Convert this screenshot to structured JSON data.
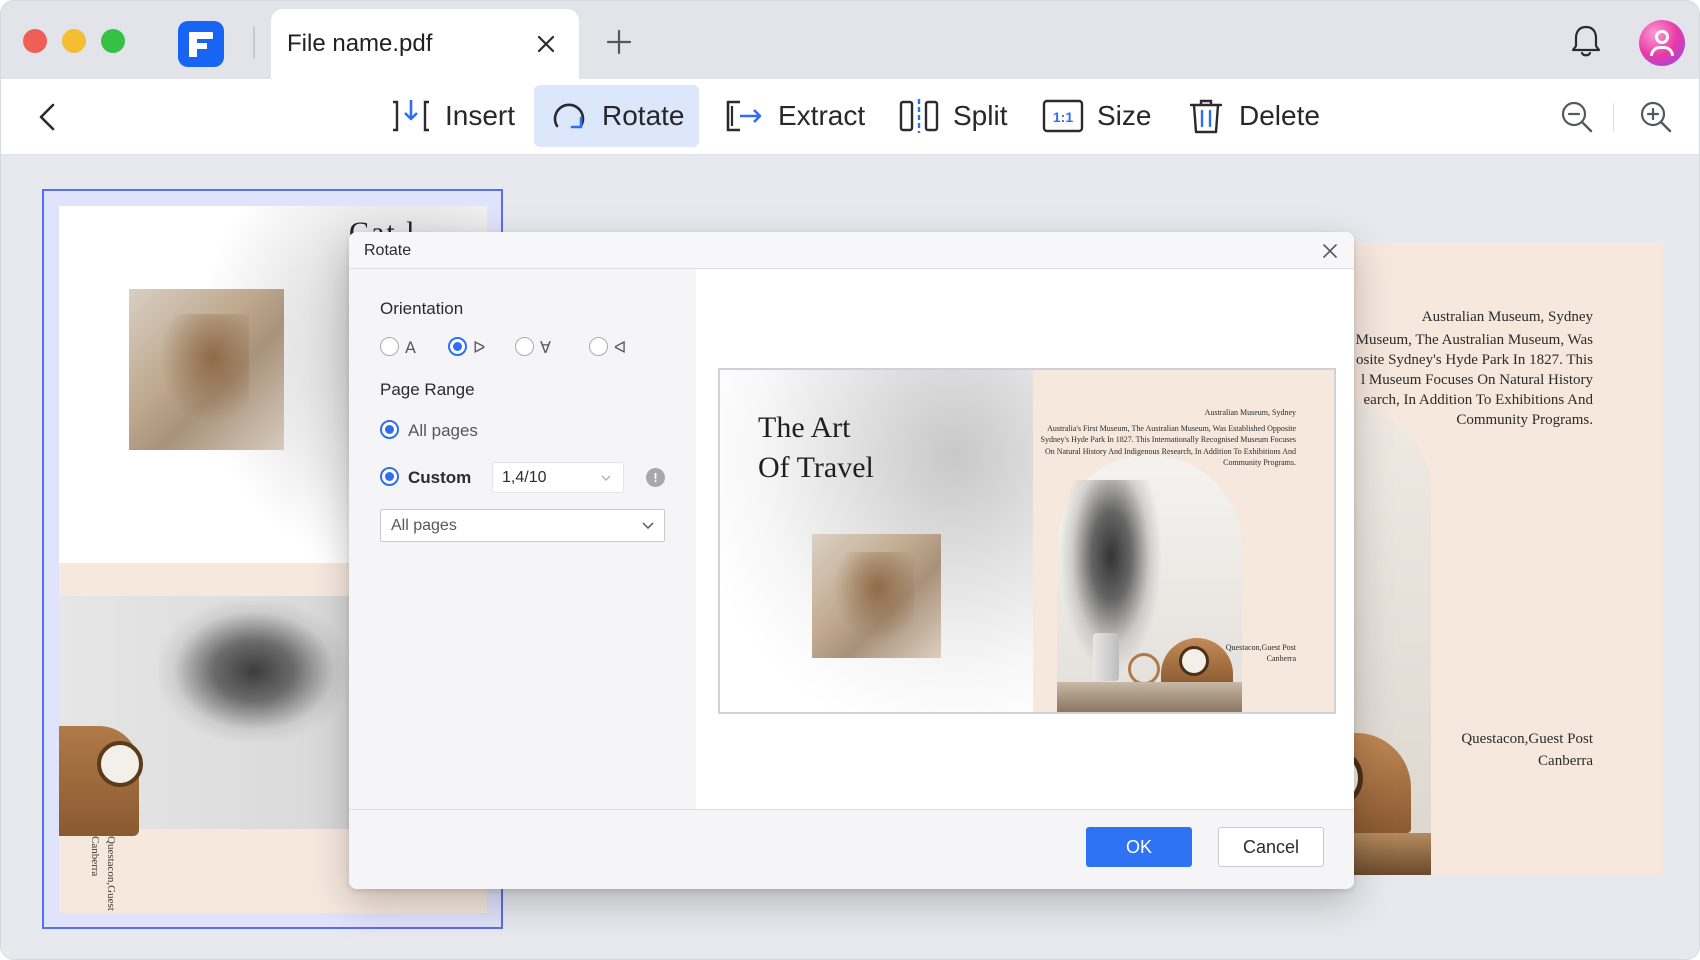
{
  "titlebar": {
    "tab_title": "File name.pdf"
  },
  "toolbar": {
    "tools": [
      {
        "label": "Insert",
        "icon": "insert-icon"
      },
      {
        "label": "Rotate",
        "icon": "rotate-icon",
        "active": true
      },
      {
        "label": "Extract",
        "icon": "extract-icon"
      },
      {
        "label": "Split",
        "icon": "split-icon"
      },
      {
        "label": "Size",
        "icon": "size-icon",
        "icon_text": "1:1"
      },
      {
        "label": "Delete",
        "icon": "trash-icon"
      }
    ],
    "accent_color": "#dde7fb"
  },
  "dialog": {
    "title": "Rotate",
    "orientation": {
      "label": "Orientation",
      "options": [
        {
          "glyph": "A",
          "selected": false
        },
        {
          "glyph": "ᐅ",
          "selected": true
        },
        {
          "glyph": "∀",
          "selected": false
        },
        {
          "glyph": "ᐊ",
          "selected": false
        }
      ]
    },
    "page_range": {
      "label": "Page Range",
      "all_pages_label": "All pages",
      "custom_label": "Custom",
      "custom_value": "1,4/10",
      "info_glyph": "!",
      "subset_value": "All pages"
    },
    "preview": {
      "title": "The Art\nOf Travel",
      "body_heading": "Australian Museum, Sydney",
      "body_text": "Australia's First Museum, The Australian Museum, Was Established Opposite Sydney's Hyde Park In 1827. This Internationally Recognised Museum Focuses On Natural History And Indigenous Research, In Addition To Exhibitions And Community Programs.",
      "caption_line1": "Questacon,Guest Post",
      "caption_line2": "Canberra"
    },
    "ok_label": "OK",
    "cancel_label": "Cancel",
    "primary_color": "#2f73f5"
  },
  "pages": {
    "left": {
      "title_fragment": "Cat l",
      "vertical_caption_line1": "Questacon,Guest Post",
      "vertical_caption_line2": "Canberra"
    },
    "right": {
      "heading": "Australian Museum, Sydney",
      "body_lines": [
        "Museum, The Australian Museum, Was",
        "osite Sydney's Hyde Park In 1827. This",
        "l Museum Focuses On Natural History",
        "earch, In Addition To Exhibitions And",
        "Community Programs."
      ],
      "caption_line1": "Questacon,Guest Post",
      "caption_line2": "Canberra"
    }
  }
}
